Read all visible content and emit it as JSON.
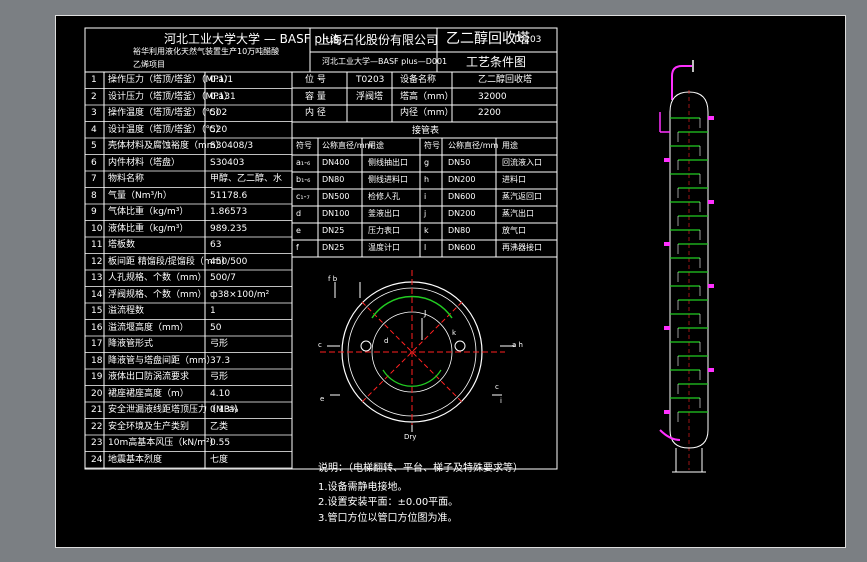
{
  "header": {
    "university_title": "河北工业大学大学 — BASF plus",
    "project_desc_1": "裕华利用液化天然气装置生产10万吨醋酸",
    "project_desc_2": "乙烯项目",
    "company": "上海石化股份有限公司",
    "drawing_title": "乙二醇回收塔",
    "drawing_no": "T0203",
    "drawing_code": "河北工业大学—BASF plus—D001",
    "drawing_subtitle": "工艺条件图"
  },
  "spec_table": [
    {
      "no": "1",
      "name": "操作压力（塔顶/塔釜）（MPa）",
      "value": "0.1/1"
    },
    {
      "no": "2",
      "name": "设计压力（塔顶/塔釜）（MPa）",
      "value": "0.131"
    },
    {
      "no": "3",
      "name": "操作温度（塔顶/塔釜）（℃）",
      "value": "502"
    },
    {
      "no": "4",
      "name": "设计温度（塔顶/塔釜）（℃）",
      "value": "520"
    },
    {
      "no": "5",
      "name": "壳体材料及腐蚀裕度（mm）",
      "value": "S30408/3"
    },
    {
      "no": "6",
      "name": "内件材料（塔盘）",
      "value": "S30403"
    },
    {
      "no": "7",
      "name": "物料名称",
      "value": "甲醇、乙二醇、水"
    },
    {
      "no": "8",
      "name": "气量（Nm³/h）",
      "value": "51178.6"
    },
    {
      "no": "9",
      "name": "气体比重（kg/m³）",
      "value": "1.86573"
    },
    {
      "no": "10",
      "name": "液体比重（kg/m³）",
      "value": "989.235"
    },
    {
      "no": "11",
      "name": "塔板数",
      "value": "63"
    },
    {
      "no": "12",
      "name": "板间距 精馏段/提馏段（mm）",
      "value": "450/500"
    },
    {
      "no": "13",
      "name": "人孔规格、个数（mm）",
      "value": "500/7"
    },
    {
      "no": "14",
      "name": "浮阀规格、个数（mm）",
      "value": "ф38×100/m²"
    },
    {
      "no": "15",
      "name": "溢流程数",
      "value": "1"
    },
    {
      "no": "16",
      "name": "溢流堰高度（mm）",
      "value": "50"
    },
    {
      "no": "17",
      "name": "降液管形式",
      "value": "弓形"
    },
    {
      "no": "18",
      "name": "降液管与塔盘间距（mm）",
      "value": "37.3"
    },
    {
      "no": "19",
      "name": "液体出口防涡流要求",
      "value": "弓形"
    },
    {
      "no": "20",
      "name": "裙座裙座高度（m）",
      "value": "4.10"
    },
    {
      "no": "21",
      "name": "安全泄漏液线距塔顶压力（MPa）",
      "value": "0.13%"
    },
    {
      "no": "22",
      "name": "安全环境及生产类别",
      "value": "乙类"
    },
    {
      "no": "23",
      "name": "10m高基本风压（kN/m²）",
      "value": "0.55"
    },
    {
      "no": "24",
      "name": "地震基本烈度",
      "value": "七度"
    }
  ],
  "tag_table": {
    "rows": [
      {
        "k1": "位 号",
        "v1": "T0203",
        "k2": "设备名称",
        "v2": "乙二醇回收塔"
      },
      {
        "k1": "容 量",
        "v1": "浮阀塔",
        "k2": "塔高（mm）",
        "v2": "32000"
      },
      {
        "k1": "内 径",
        "v1": "",
        "k2": "内径（mm）",
        "v2": "2200"
      }
    ]
  },
  "nozzle_table": {
    "title": "接管表",
    "headers": [
      "符号",
      "公称直径/mm",
      "用途",
      "符号",
      "公称直径/mm",
      "用途"
    ],
    "rows": [
      [
        "a₁-₆",
        "DN400",
        "侧线抽出口",
        "g",
        "DN50",
        "回流液入口"
      ],
      [
        "b₁-₆",
        "DN80",
        "侧线进料口",
        "h",
        "DN200",
        "进料口"
      ],
      [
        "c₁-₇",
        "DN500",
        "检修人孔",
        "i",
        "DN600",
        "蒸汽返回口"
      ],
      [
        "d",
        "DN100",
        "釜液出口",
        "j",
        "DN200",
        "蒸汽出口"
      ],
      [
        "e",
        "DN25",
        "压力表口",
        "k",
        "DN80",
        "放气口"
      ],
      [
        "f",
        "DN25",
        "温度计口",
        "l",
        "DN600",
        "再沸器接口"
      ]
    ]
  },
  "plan_view": {
    "labels": [
      "f b",
      "a h",
      "c",
      "d",
      "k",
      "J",
      "e",
      "c",
      "i",
      "Dry"
    ]
  },
  "notes": {
    "title": "说明：（电梯翻转、平台、梯子及特殊要求等）",
    "items": [
      "1.设备需静电接地。",
      "2.设置安装平面：±0.00平面。",
      "3.管口方位以管口方位图为准。"
    ]
  },
  "colors": {
    "background": "#7b7f83",
    "sheet": "#000000",
    "line": "#ffffff",
    "accent_red": "#ff2020",
    "accent_green": "#22cc22",
    "accent_magenta": "#ff30ff"
  }
}
